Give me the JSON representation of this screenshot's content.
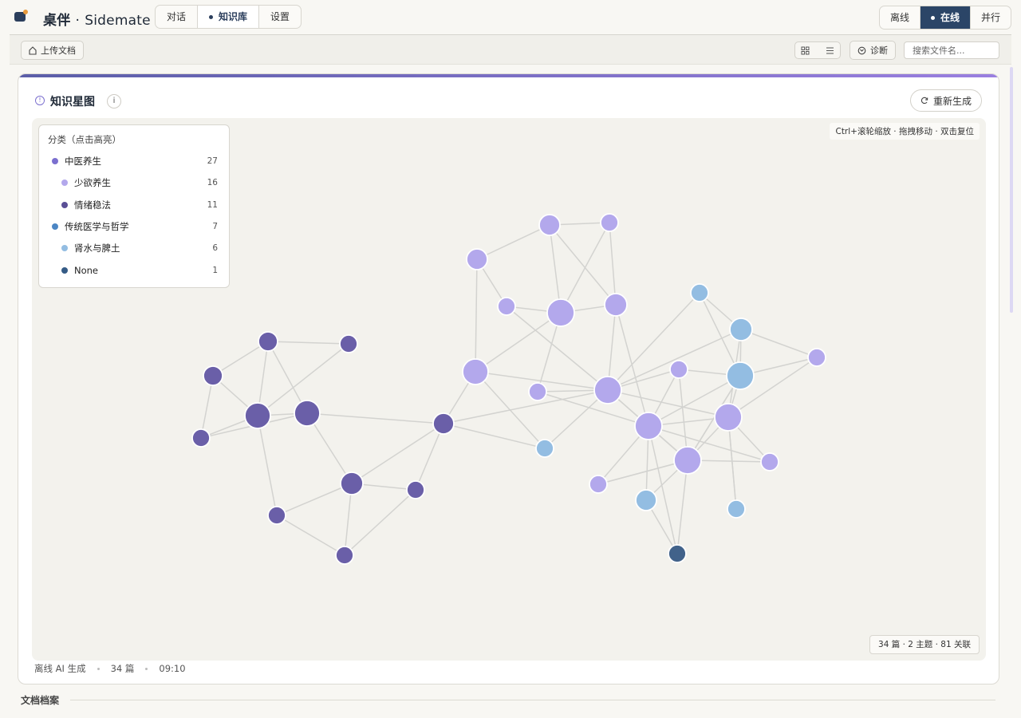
{
  "brand": {
    "name": "桌伴",
    "separator": "·",
    "sub": "Sidemate"
  },
  "nav": {
    "tabs": [
      "对话",
      "知识库",
      "设置"
    ],
    "active": 1
  },
  "mode": {
    "options": [
      "离线",
      "在线",
      "并行"
    ],
    "active": 1
  },
  "toolbar": {
    "upload_label": "上传文档",
    "diag_label": "诊断",
    "search_placeholder": "搜索文件名..."
  },
  "card": {
    "title": "知识星图",
    "info": "i",
    "regen_label": "重新生成",
    "hint": "Ctrl+滚轮缩放 · 拖拽移动 · 双击复位",
    "stats": "34 篇 · 2 主题 · 81 关联",
    "footer": [
      "离线 AI 生成",
      "34 篇",
      "09:10"
    ]
  },
  "legend": {
    "title": "分类（点击高亮）",
    "items": [
      {
        "label": "中医养生",
        "count": "27",
        "color": "#7b6fcf",
        "level": 0
      },
      {
        "label": "少欲养生",
        "count": "16",
        "color": "#b3a8ec",
        "level": 1
      },
      {
        "label": "情绪稳法",
        "count": "11",
        "color": "#5a4f96",
        "level": 1
      },
      {
        "label": "传统医学与哲学",
        "count": "7",
        "color": "#4c86c4",
        "level": 0
      },
      {
        "label": "肾水与脾土",
        "count": "6",
        "color": "#93bde2",
        "level": 1
      },
      {
        "label": "None",
        "count": "1",
        "color": "#355b86",
        "level": 1
      }
    ]
  },
  "archive_label": "文档档案",
  "colors": {
    "accent": "#2b4567",
    "violet": "#7b6fcf",
    "light_violet": "#b3a8ec",
    "dark_violet": "#6a5fa8",
    "light_blue": "#93bde2",
    "navy": "#41628a"
  },
  "chart_data": {
    "type": "network",
    "node_count": 34,
    "edge_count": 81,
    "categories": [
      "少欲养生",
      "情绪稳法",
      "肾水与脾土",
      "None"
    ]
  }
}
